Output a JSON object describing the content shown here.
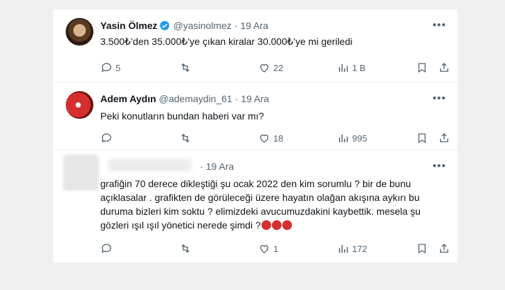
{
  "tweets": [
    {
      "name": "Yasin Ölmez",
      "handle": "@yasinolmez",
      "separator": "·",
      "date": "19 Ara",
      "text": "3.500₺’den 35.000₺’ye çıkan kiralar 30.000₺’ye mi geriledi",
      "replies": "5",
      "retweets": "",
      "likes": "22",
      "views": "1 B"
    },
    {
      "name": "Adem Aydın",
      "handle": "@ademaydin_61",
      "separator": "·",
      "date": "19 Ara",
      "text": "Peki konutların bundan haberi var mı?",
      "replies": "",
      "retweets": "",
      "likes": "18",
      "views": "995"
    },
    {
      "name": "",
      "handle": "",
      "separator": "·",
      "date": "19 Ara",
      "text": "grafiğin 70 derece dikleştiği şu ocak 2022 den kim sorumlu ? bir de bunu açıklasalar . grafikten de görüleceği üzere hayatın olağan akışına aykırı bu duruma bizleri kim soktu ? elimizdeki avucumuzdakini kaybettik. mesela şu gözleri ışıl ışıl yönetici nerede şimdi ?",
      "replies": "",
      "retweets": "",
      "likes": "1",
      "views": "172"
    }
  ],
  "more_label": "•••",
  "colors": {
    "text": "#0f1419",
    "muted": "#536471",
    "verified": "#1d9bf0",
    "emoji": "#d32f2f"
  }
}
